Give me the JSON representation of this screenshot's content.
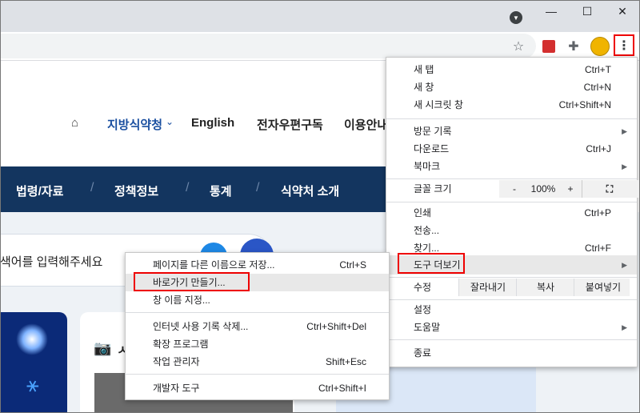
{
  "window": {
    "minimize": "—",
    "maximize": "☐",
    "close": "✕"
  },
  "toolbar": {
    "star_icon": "star-icon",
    "pdf_icon": "acrobat-icon",
    "extensions_icon": "puzzle-icon",
    "menu_icon": "kebab-menu-icon"
  },
  "page": {
    "topnav": [
      "지방식약청",
      "English",
      "전자우편구독",
      "이용안내"
    ],
    "bluebar": [
      "법령/자료",
      "정책정보",
      "통계",
      "식약처 소개"
    ],
    "search_text": "색어를 입력해주세요",
    "card_letter": "ㅅ"
  },
  "main_menu": {
    "new_tab": "새 탭",
    "new_tab_sc": "Ctrl+T",
    "new_window": "새 창",
    "new_window_sc": "Ctrl+N",
    "incognito": "새 시크릿 창",
    "incognito_sc": "Ctrl+Shift+N",
    "history": "방문 기록",
    "downloads": "다운로드",
    "downloads_sc": "Ctrl+J",
    "bookmarks": "북마크",
    "zoom_label": "글꼴 크기",
    "zoom_minus": "-",
    "zoom_value": "100%",
    "zoom_plus": "+",
    "print": "인쇄",
    "print_sc": "Ctrl+P",
    "cast": "전송...",
    "find": "찾기...",
    "find_sc": "Ctrl+F",
    "more_tools": "도구 더보기",
    "edit_label": "수정",
    "cut": "잘라내기",
    "copy": "복사",
    "paste": "붙여넣기",
    "settings": "설정",
    "help": "도움말",
    "exit": "종료"
  },
  "sub_menu": {
    "save_as": "페이지를 다른 이름으로 저장...",
    "save_as_sc": "Ctrl+S",
    "create_shortcut": "바로가기 만들기...",
    "name_window": "창 이름 지정...",
    "clear_data": "인터넷 사용 기록 삭제...",
    "clear_data_sc": "Ctrl+Shift+Del",
    "extensions": "확장 프로그램",
    "task_manager": "작업 관리자",
    "task_manager_sc": "Shift+Esc",
    "dev_tools": "개발자 도구",
    "dev_tools_sc": "Ctrl+Shift+I"
  },
  "colors": {
    "highlight": "#e00000",
    "navy": "#13355f"
  }
}
